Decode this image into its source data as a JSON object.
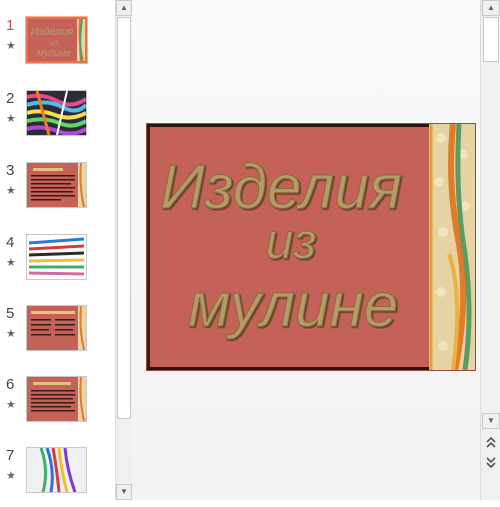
{
  "slides": [
    {
      "number": "1",
      "selected": true,
      "title_lines": [
        "Изделия",
        "из",
        "мулине"
      ]
    },
    {
      "number": "2",
      "selected": false
    },
    {
      "number": "3",
      "selected": false
    },
    {
      "number": "4",
      "selected": false
    },
    {
      "number": "5",
      "selected": false
    },
    {
      "number": "6",
      "selected": false
    },
    {
      "number": "7",
      "selected": false
    }
  ],
  "star_icon": "★",
  "main_slide": {
    "title_line1": "Изделия",
    "title_line2": "из",
    "title_line3": "мулине",
    "background_color": "#c4625a",
    "text_color": "#b59a6a"
  },
  "scrollbar": {
    "up_icon": "up-arrow-icon",
    "down_icon": "down-arrow-icon",
    "prev_slide_icon": "double-up-arrow-icon",
    "next_slide_icon": "double-down-arrow-icon"
  }
}
